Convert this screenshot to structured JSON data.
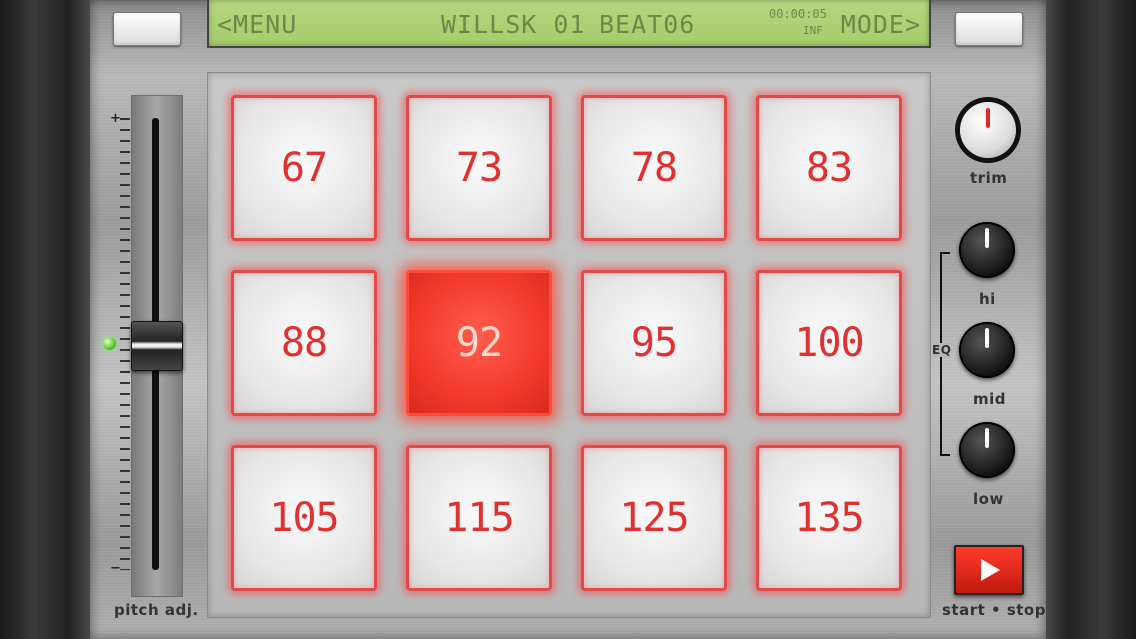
{
  "lcd": {
    "menu": "<MENU",
    "kit": "WILLSK 01",
    "beat": "BEAT06",
    "time": "00:00:05",
    "loop": "INF",
    "mode": "MODE>"
  },
  "pads": [
    {
      "label": "67",
      "active": false
    },
    {
      "label": "73",
      "active": false
    },
    {
      "label": "78",
      "active": false
    },
    {
      "label": "83",
      "active": false
    },
    {
      "label": "88",
      "active": false
    },
    {
      "label": "92",
      "active": true
    },
    {
      "label": "95",
      "active": false
    },
    {
      "label": "100",
      "active": false
    },
    {
      "label": "105",
      "active": false
    },
    {
      "label": "115",
      "active": false
    },
    {
      "label": "125",
      "active": false
    },
    {
      "label": "135",
      "active": false
    }
  ],
  "fader": {
    "label": "pitch adj.",
    "plus": "+",
    "minus": "−",
    "level": 0.5
  },
  "knobs": {
    "trim": "trim",
    "eq": "EQ",
    "hi": "hi",
    "mid": "mid",
    "low": "low"
  },
  "transport": {
    "label": "start • stop"
  },
  "colors": {
    "pad_glow": "#e03030",
    "lcd": "#a5cc6a",
    "led": "#5cc92c"
  }
}
